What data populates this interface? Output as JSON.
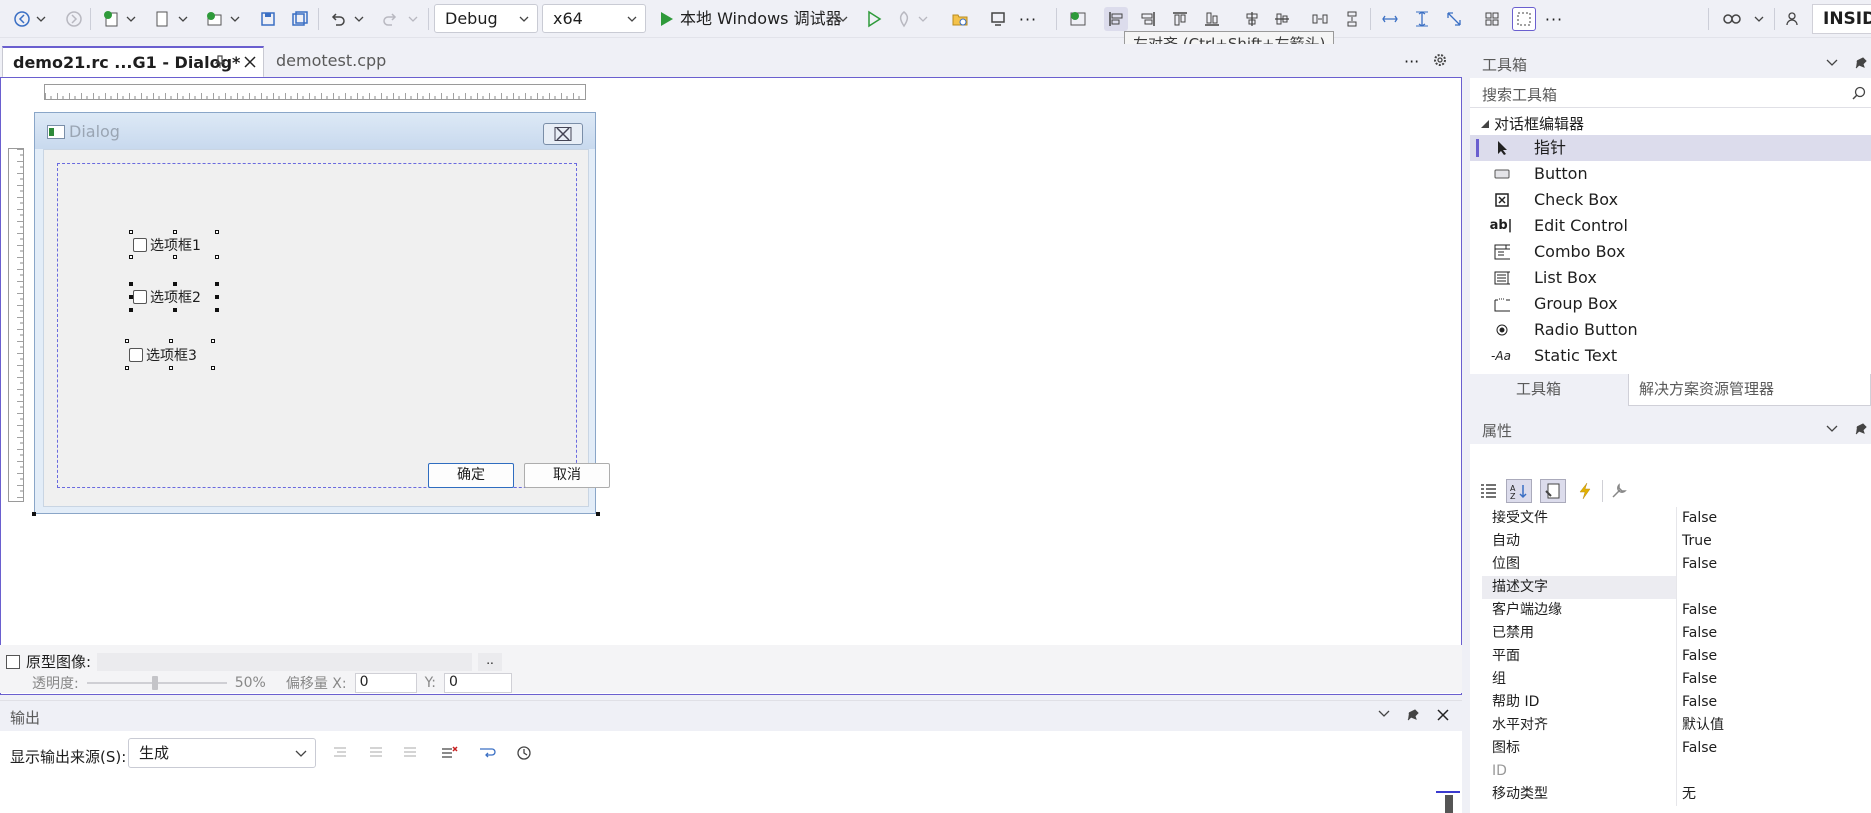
{
  "toolbar": {
    "config": "Debug",
    "platform": "x64",
    "run_label": "本地 Windows 调试器",
    "tooltip": "左对齐 (Ctrl+Shift+左箭头)",
    "badge": "INSIDE"
  },
  "tabs": {
    "active": "demo21.rc ...G1 - Dialog*",
    "second": "demotest.cpp"
  },
  "dialog": {
    "title": "Dialog",
    "checkbox1": "选项框1",
    "checkbox2": "选项框2",
    "checkbox3": "选项框3",
    "ok": "确定",
    "cancel": "取消"
  },
  "overlay": {
    "proto_label": "原型图像:",
    "ellipsis": "..",
    "opacity_label": "透明度:",
    "opacity_value": "50%",
    "offset_label": "偏移量 X:",
    "offset_x": "0",
    "y_label": "Y:",
    "offset_y": "0"
  },
  "output": {
    "title": "输出",
    "source_label": "显示输出来源(S):",
    "source_value": "生成"
  },
  "toolbox": {
    "title": "工具箱",
    "search_placeholder": "搜索工具箱",
    "group": "对话框编辑器",
    "items": [
      {
        "label": "指针",
        "icon": "pointer-icon"
      },
      {
        "label": "Button",
        "icon": "button-icon"
      },
      {
        "label": "Check Box",
        "icon": "checkbox-icon"
      },
      {
        "label": "Edit Control",
        "icon": "edit-control-icon"
      },
      {
        "label": "Combo Box",
        "icon": "combo-box-icon"
      },
      {
        "label": "List Box",
        "icon": "list-box-icon"
      },
      {
        "label": "Group Box",
        "icon": "group-box-icon"
      },
      {
        "label": "Radio Button",
        "icon": "radio-button-icon"
      },
      {
        "label": "Static Text",
        "icon": "static-text-icon"
      }
    ],
    "tab_toolbox": "工具箱",
    "tab_solution": "解决方案资源管理器"
  },
  "properties": {
    "title": "属性",
    "rows": [
      {
        "name": "接受文件",
        "value": "False"
      },
      {
        "name": "自动",
        "value": "True"
      },
      {
        "name": "位图",
        "value": "False"
      },
      {
        "name": "描述文字",
        "value": ""
      },
      {
        "name": "客户端边缘",
        "value": "False"
      },
      {
        "name": "已禁用",
        "value": "False"
      },
      {
        "name": "平面",
        "value": "False"
      },
      {
        "name": "组",
        "value": "False"
      },
      {
        "name": "帮助 ID",
        "value": "False"
      },
      {
        "name": "水平对齐",
        "value": "默认值"
      },
      {
        "name": "图标",
        "value": "False"
      },
      {
        "name": "ID",
        "value": ""
      },
      {
        "name": "移动类型",
        "value": "无"
      }
    ]
  }
}
